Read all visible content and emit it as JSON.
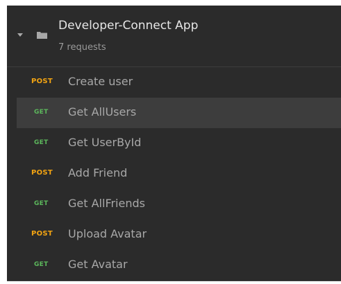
{
  "collection": {
    "title": "Developer-Connect App",
    "count_label": "7 requests",
    "expanded": true,
    "icons": {
      "caret": "caret-down-icon",
      "folder": "folder-icon"
    }
  },
  "requests": [
    {
      "method": "POST",
      "name": "Create user",
      "selected": false
    },
    {
      "method": "GET",
      "name": "Get AllUsers",
      "selected": true
    },
    {
      "method": "GET",
      "name": "Get UserById",
      "selected": false
    },
    {
      "method": "POST",
      "name": "Add Friend",
      "selected": false
    },
    {
      "method": "GET",
      "name": "Get AllFriends",
      "selected": false
    },
    {
      "method": "POST",
      "name": "Upload Avatar",
      "selected": false
    },
    {
      "method": "GET",
      "name": "Get Avatar",
      "selected": false
    }
  ],
  "colors": {
    "panel_bg": "#2b2b2b",
    "selected_bg": "#3d3d3d",
    "post": "#f3a412",
    "get": "#5cb85c",
    "title_text": "#e6e6e6",
    "muted_text": "#9a9a9a"
  }
}
